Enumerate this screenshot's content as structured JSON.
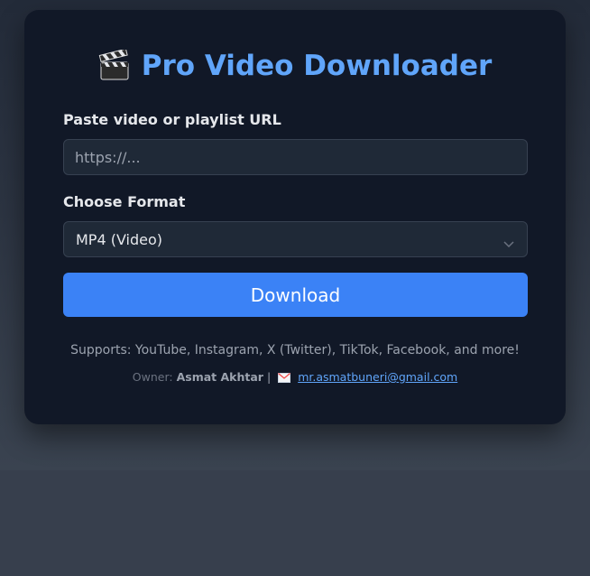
{
  "header": {
    "icon": "clapper-board-icon",
    "title": "Pro Video Downloader"
  },
  "form": {
    "url_label": "Paste video or playlist URL",
    "url_placeholder": "https://...",
    "url_value": "",
    "format_label": "Choose Format",
    "format_selected": "MP4 (Video)",
    "download_label": "Download"
  },
  "footer": {
    "supports_text": "Supports: YouTube, Instagram, X (Twitter), TikTok, Facebook, and more!",
    "owner_prefix": "Owner:",
    "owner_name": "Asmat Akhtar",
    "separator": "|",
    "mail_icon": "envelope-icon",
    "email": "mr.asmatbuneri@gmail.com"
  },
  "colors": {
    "accent": "#60a5fa",
    "button": "#3b82f6",
    "card": "#111827",
    "field": "#1f2937"
  }
}
